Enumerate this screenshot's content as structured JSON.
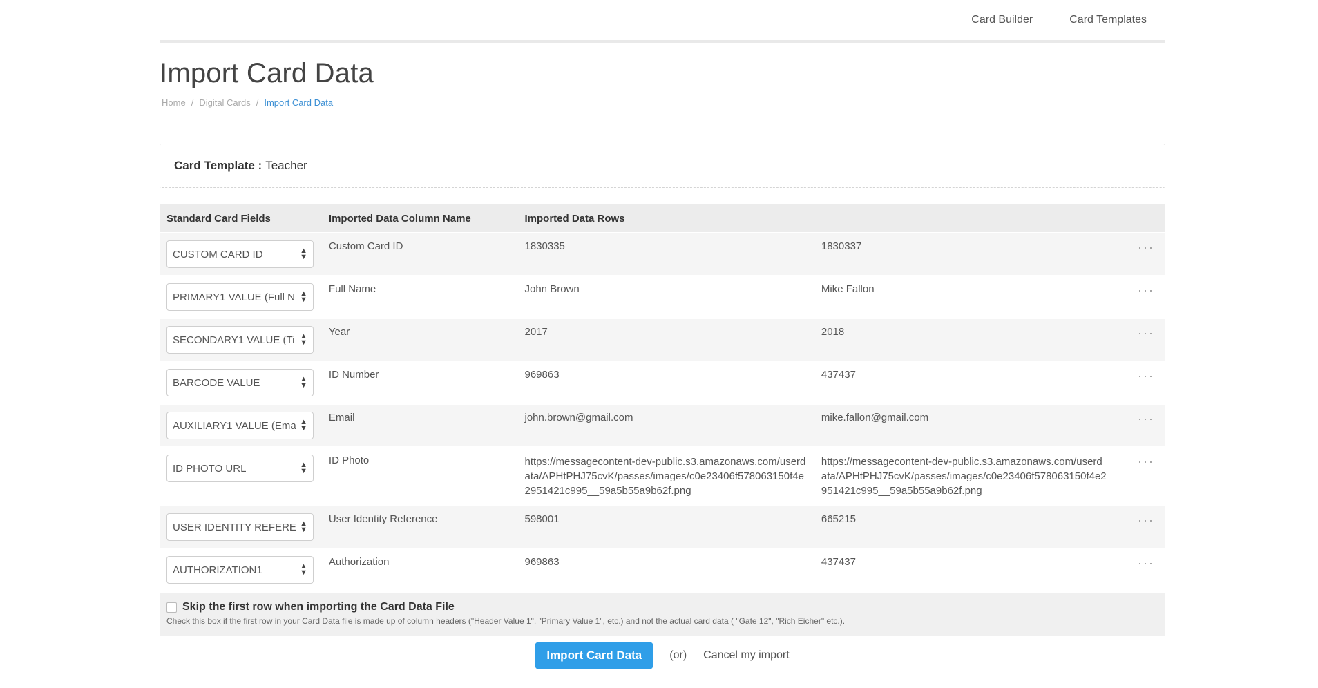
{
  "nav": {
    "card_builder": "Card Builder",
    "card_templates": "Card Templates"
  },
  "page": {
    "title": "Import Card Data"
  },
  "breadcrumb": {
    "home": "Home",
    "digital_cards": "Digital Cards",
    "current": "Import Card Data",
    "separator": "/"
  },
  "template": {
    "label": "Card Template :",
    "value": "Teacher"
  },
  "table": {
    "headers": [
      "Standard Card Fields",
      "Imported Data Column Name",
      "Imported Data Rows",
      ""
    ],
    "rows": [
      {
        "field": "CUSTOM CARD ID",
        "column": "Custom Card ID",
        "row1": "1830335",
        "row2": "1830337",
        "more": "···"
      },
      {
        "field": "PRIMARY1 VALUE (Full N",
        "column": "Full Name",
        "row1": "John Brown",
        "row2": "Mike Fallon",
        "more": "···"
      },
      {
        "field": "SECONDARY1 VALUE (Ti",
        "column": "Year",
        "row1": "2017",
        "row2": "2018",
        "more": "···"
      },
      {
        "field": "BARCODE VALUE",
        "column": "ID Number",
        "row1": "969863",
        "row2": "437437",
        "more": "···"
      },
      {
        "field": "AUXILIARY1 VALUE (Ema",
        "column": "Email",
        "row1": "john.brown@gmail.com",
        "row2": "mike.fallon@gmail.com",
        "more": "···"
      },
      {
        "field": "ID PHOTO URL",
        "column": "ID Photo",
        "row1": "https://messagecontent-dev-public.s3.amazonaws.com/userdata/APHtPHJ75cvK/passes/images/c0e23406f578063150f4e2951421c995__59a5b55a9b62f.png",
        "row2": "https://messagecontent-dev-public.s3.amazonaws.com/userdata/APHtPHJ75cvK/passes/images/c0e23406f578063150f4e2951421c995__59a5b55a9b62f.png",
        "more": "···"
      },
      {
        "field": "USER IDENTITY REFEREN",
        "column": "User Identity Reference",
        "row1": "598001",
        "row2": "665215",
        "more": "···"
      },
      {
        "field": "AUTHORIZATION1",
        "column": "Authorization",
        "row1": "969863",
        "row2": "437437",
        "more": "···"
      }
    ]
  },
  "skip": {
    "label": "Skip the first row when importing the Card Data File",
    "help": "Check this box if the first row in your Card Data file is made up of column headers (\"Header Value 1\", \"Primary Value 1\", etc.) and not the actual card data ( \"Gate 12\", \"Rich Eicher\" etc.).",
    "checked": false
  },
  "actions": {
    "import_label": "Import Card Data",
    "or_label": "(or)",
    "cancel_label": "Cancel my import"
  },
  "colors": {
    "accent": "#2f9ee8",
    "breadcrumb_active": "#3b8fd4"
  }
}
